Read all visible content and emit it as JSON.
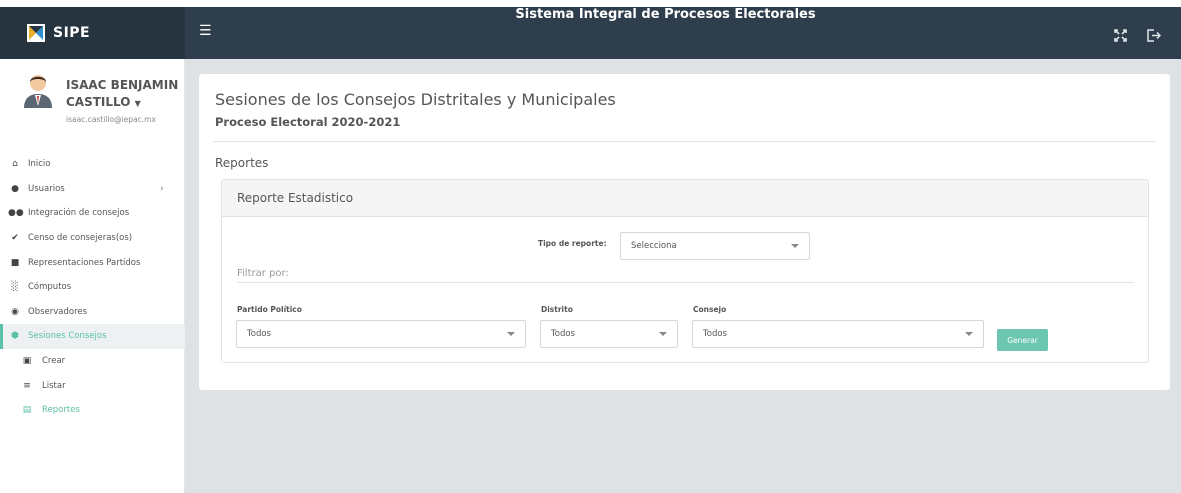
{
  "header": {
    "logo_text": "SIPE",
    "menu_icon": "hamburger-icon",
    "title": "Sistema Integral de Procesos Electorales",
    "icons": [
      "expand-icon",
      "logout-icon"
    ]
  },
  "user": {
    "name": "ISAAC BENJAMIN CASTILLO",
    "email": "isaac.castillo@iepac.mx"
  },
  "sidebar": {
    "items": [
      {
        "label": "Inicio",
        "icon": "home-icon"
      },
      {
        "label": "Usuarios",
        "icon": "users-icon"
      },
      {
        "label": "Integración de consejos",
        "icon": "group-icon"
      },
      {
        "label": "Censo de consejeras(os)",
        "icon": "check-icon"
      },
      {
        "label": "Representaciones Partidos",
        "icon": "people-icon"
      },
      {
        "label": "Cómputos",
        "icon": "bar-chart-icon"
      },
      {
        "label": "Observadores",
        "icon": "eye-icon"
      },
      {
        "label": "Sesiones Consejos",
        "icon": "hexagon-icon"
      }
    ],
    "sub_items": [
      {
        "label": "Crear",
        "icon": "file-plus-icon"
      },
      {
        "label": "Listar",
        "icon": "list-icon"
      },
      {
        "label": "Reportes",
        "icon": "pdf-icon"
      }
    ]
  },
  "main": {
    "title": "Sesiones de los Consejos Distritales y Municipales",
    "subtitle": "Proceso Electoral 2020-2021",
    "section": "Reportes",
    "panel_title": "Reporte Estadistico",
    "tipo_label": "Tipo de reporte:",
    "tipo_value": "Selecciona",
    "filter_label": "Filtrar por:",
    "partido_label": "Partido Político",
    "partido_value": "Todos",
    "distrito_label": "Distrito",
    "distrito_value": "Todos",
    "consejo_label": "Consejo",
    "consejo_value": "Todos",
    "generate_label": "Generar"
  },
  "colors": {
    "topbar": "#2f3e4c",
    "accent": "#5bc0a8",
    "button": "#6cc6b0",
    "background": "#dfe2e4"
  }
}
